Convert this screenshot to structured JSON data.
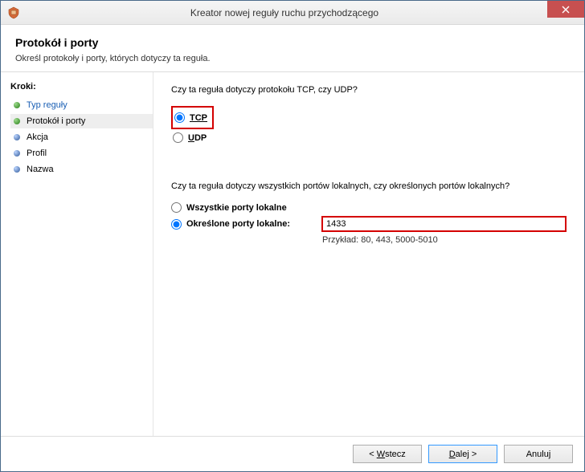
{
  "window": {
    "title": "Kreator nowej reguły ruchu przychodzącego"
  },
  "header": {
    "title": "Protokół i porty",
    "subtitle": "Określ protokoły i porty, których dotyczy ta reguła."
  },
  "sidebar": {
    "steps_label": "Kroki:",
    "steps": [
      {
        "label": "Typ reguły",
        "state": "done"
      },
      {
        "label": "Protokół i porty",
        "state": "current"
      },
      {
        "label": "Akcja",
        "state": "future"
      },
      {
        "label": "Profil",
        "state": "future"
      },
      {
        "label": "Nazwa",
        "state": "future"
      }
    ]
  },
  "main": {
    "q1": "Czy ta reguła dotyczy protokołu TCP, czy UDP?",
    "protocol": {
      "tcp": "TCP",
      "udp": "UDP",
      "selected": "tcp"
    },
    "q2": "Czy ta reguła dotyczy wszystkich portów lokalnych, czy określonych portów lokalnych?",
    "ports": {
      "all_label": "Wszystkie porty lokalne",
      "specific_label": "Określone porty lokalne:",
      "selected": "specific",
      "value": "1433",
      "example": "Przykład: 80, 443, 5000-5010"
    }
  },
  "footer": {
    "back": "< Wstecz",
    "next": "Dalej >",
    "cancel": "Anuluj"
  }
}
